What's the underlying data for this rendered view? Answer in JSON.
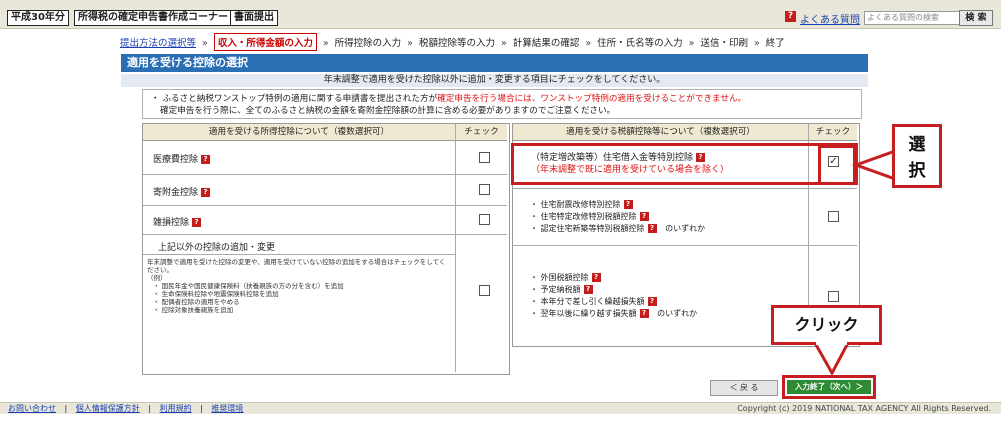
{
  "header": {
    "year_tag": "平成30年分",
    "app_tag": "所得税の確定申告書作成コーナー",
    "mode_tag": "書面提出",
    "faq_label": "よくある質問",
    "search_placeholder": "よくある質問の検索",
    "search_button": "検 索"
  },
  "steps": [
    "提出方法の選択等",
    "収入・所得金額の入力",
    "所得控除の入力",
    "税額控除等の入力",
    "計算結果の確認",
    "住所・氏名等の入力",
    "送信・印刷",
    "終了"
  ],
  "step_sep": "»",
  "page": {
    "title": "適用を受ける控除の選択",
    "subtitle": "年末調整で適用を受けた控除以外に追加・変更する項目にチェックをしてください。",
    "notice_bullet": "・",
    "notice_line1_black": "ふるさと納税ワンストップ特例の適用に関する申請書を提出された方が",
    "notice_line1_red": "確定申告を行う場合には、ワンストップ特例の適用を受けることができません。",
    "notice_line2": "確定申告を行う際に、全てのふるさと納税の金額を寄附金控除額の計算に含める必要がありますのでご注意ください。"
  },
  "left_table": {
    "col_header": "適用を受ける所得控除について（複数選択可）",
    "check_header": "チェック",
    "rows": [
      {
        "label": "医療費控除",
        "checked": false
      },
      {
        "label": "寄附金控除",
        "checked": false
      },
      {
        "label": "雑損控除",
        "checked": false
      }
    ],
    "other_header": "上記以外の控除の追加・変更",
    "other_desc": "年末調整で適用を受けた控除の変更や、適用を受けていない控除の追加をする場合はチェックをしてください。",
    "other_example": "（例）",
    "other_items": [
      "国民年金や国民健康保険料（扶養親族の方の分を含む）を追加",
      "生命保険料控除や地震保険料控除を追加",
      "配偶者控除の適用をやめる",
      "控除対象扶養親族を追加"
    ]
  },
  "right_table": {
    "col_header": "適用を受ける税額控除等について（複数選択可）",
    "check_header": "チェック",
    "housing": {
      "label": "（特定増改築等）住宅借入金等特別控除",
      "note": "（年末調整で既に適用を受けている場合を除く）",
      "checked": true
    },
    "group2": {
      "items": [
        "住宅耐震改修特別控除",
        "住宅特定改修特別税額控除",
        "認定住宅新築等特別税額控除"
      ],
      "suffix": "のいずれか",
      "checked": false
    },
    "group3": {
      "items": [
        "外国税額控除",
        "予定納税額",
        "本年分で差し引く繰越損失額",
        "翌年以後に繰り越す損失額"
      ],
      "suffix": "のいずれか",
      "checked": false
    }
  },
  "annotations": {
    "select_label": "選択",
    "click_label": "クリック",
    "accent_color": "#c71f1f"
  },
  "buttons": {
    "back": "＜ 戻 る",
    "next": "入力終了（次へ）＞"
  },
  "footer": {
    "links": [
      "お問い合わせ",
      "個人情報保護方針",
      "利用規約",
      "推奨環境"
    ],
    "link_sep": "|",
    "copyright": "Copyright (c) 2019 NATIONAL TAX AGENCY All Rights Reserved."
  }
}
